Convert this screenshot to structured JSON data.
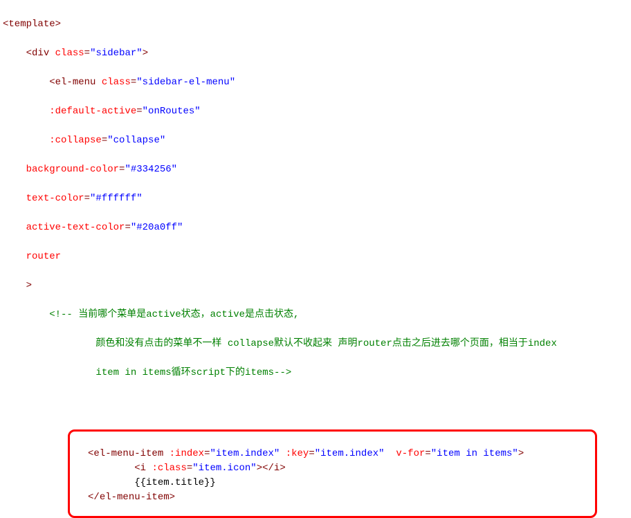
{
  "code": {
    "l1_open_template": "<template>",
    "l2": "    <div class=\"sidebar\">",
    "l3": "        <el-menu class=\"sidebar-el-menu\"",
    "l4": "        :default-active=\"onRoutes\"",
    "l5": "        :collapse=\"collapse\"",
    "l6": "    background-color=\"#334256\"",
    "l7": "    text-color=\"#ffffff\"",
    "l8": "    active-text-color=\"#20a0ff\"",
    "l9": "    router",
    "l10": "    >",
    "l11a": "    <!-- 当前哪个菜单是active状态，active是点击状态,",
    "l11b": "        颜色和没有点击的菜单不一样 collapse默认不收起来 声明router点击之后进去哪个页面，相当于index",
    "l11c": "        item in items循环script下的items-->",
    "box": {
      "l1": "<el-menu-item :index=\"item.index\" :key=\"item.index\"  v-for=\"item in items\">",
      "l2": "        <i :class=\"item.icon\"></i>",
      "l3": "        {{item.title}}",
      "l4": "</el-menu-item>"
    }
  }
}
